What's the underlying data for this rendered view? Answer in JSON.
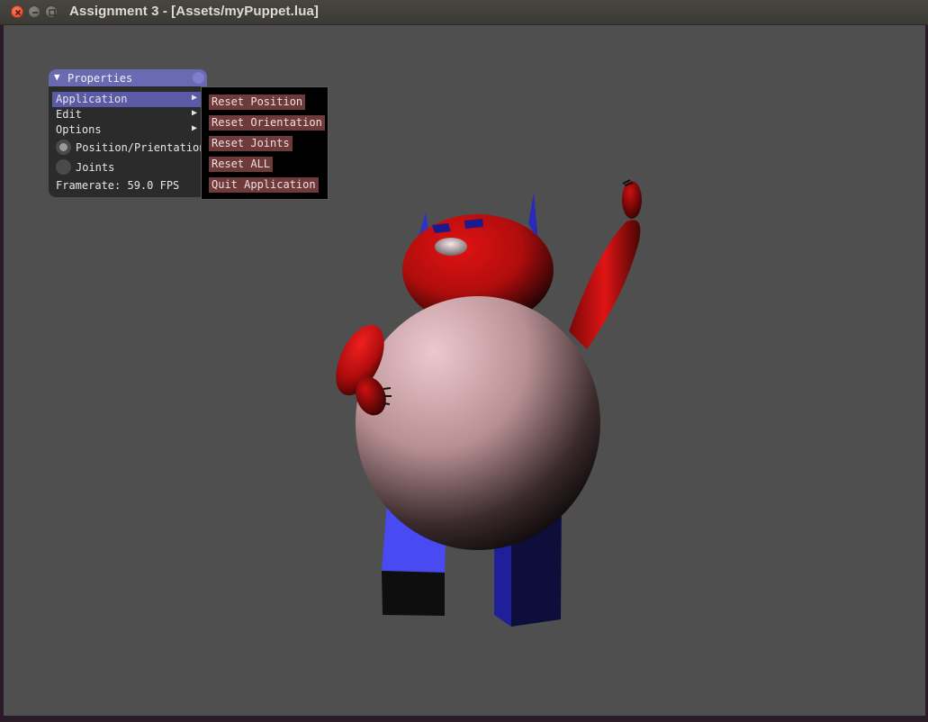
{
  "window": {
    "title": "Assignment 3 - [Assets/myPuppet.lua]",
    "buttons": [
      "close-icon",
      "minimize-icon",
      "maximize-icon"
    ]
  },
  "panel": {
    "title": "Properties",
    "collapse_icon": "triangle-down-icon",
    "menu": [
      {
        "label": "Application",
        "active": true
      },
      {
        "label": "Edit",
        "active": false
      },
      {
        "label": "Options",
        "active": false
      }
    ],
    "radios": [
      {
        "label": "Position/Prientation",
        "selected": true
      },
      {
        "label": "Joints",
        "selected": false
      }
    ],
    "framerate": "Framerate: 59.0 FPS"
  },
  "submenu": {
    "items": [
      "Reset Position",
      "Reset Orientation",
      "Reset Joints",
      "Reset ALL",
      "Quit Application"
    ]
  },
  "colors": {
    "viewport_bg": "#4f4f4f",
    "panel_title": "#6a6ab2",
    "menu_button": "#6e3a3a",
    "puppet_red": "#cc1111",
    "puppet_body": "#d8b8bc",
    "puppet_blue": "#3b3bd6"
  }
}
